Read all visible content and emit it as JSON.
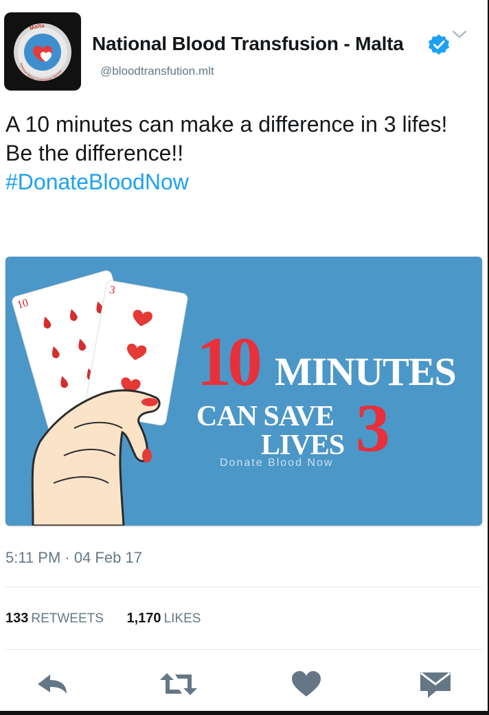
{
  "author": {
    "name": "National Blood Transfusion - Malta",
    "handle": "@bloodtransfution.mlt",
    "avatar_text_top": "Malta",
    "avatar_text_ring": "National Blood Transfusion Service"
  },
  "tweet": {
    "text": "A 10 minutes can make a difference in 3 lifes! Be the difference!!",
    "hashtag": "#DonateBloodNow",
    "timestamp": "5:11 PM · 04 Feb 17"
  },
  "media": {
    "headline_number": "10",
    "headline_word": "MINUTES",
    "line2": "CAN SAVE",
    "line3": "LIVES",
    "big_number": "3",
    "tagline": "Donate Blood Now",
    "card_left_rank": "10",
    "card_right_rank": "3",
    "colors": {
      "background": "#4b97c8",
      "accent": "#e8303a"
    }
  },
  "stats": {
    "retweets_count": "133",
    "retweets_label": "RETWEETS",
    "likes_count": "1,170",
    "likes_label": "LIKES"
  },
  "actions": [
    "reply-icon",
    "retweet-icon",
    "like-icon",
    "message-icon"
  ],
  "colors": {
    "link": "#1da1f2",
    "muted": "#657786",
    "verified": "#1da1f2"
  }
}
